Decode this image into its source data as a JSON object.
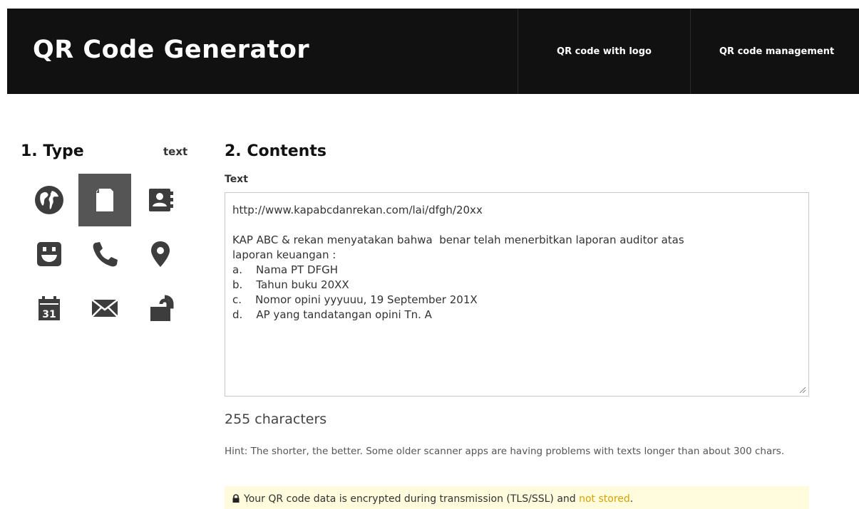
{
  "header": {
    "brand": "QR Code Generator",
    "nav": [
      "QR code with logo",
      "QR code management"
    ]
  },
  "type_section": {
    "title": "1. Type",
    "current": "text",
    "icons": [
      "globe-icon",
      "document-icon",
      "contact-card-icon",
      "smiley-icon",
      "phone-icon",
      "location-pin-icon",
      "calendar-icon",
      "envelope-icon",
      "unlock-icon"
    ],
    "calendar_day": "31",
    "selected": "document-icon"
  },
  "contents_section": {
    "title": "2. Contents",
    "field_label": "Text",
    "text_lines": [
      "http://www.kapabcdanrekan.com/lai/dfgh/20xx",
      "",
      "KAP ABC & rekan menyatakan bahwa  benar telah menerbitkan laporan auditor atas",
      "laporan keuangan :",
      "a.    Nama PT DFGH",
      "b.    Tahun buku 20XX",
      "c.    Nomor opini yyyuuu, 19 September 201X",
      "d.    AP yang tandatangan opini Tn. A"
    ],
    "char_count": "255 characters",
    "hint": "Hint: The shorter, the better. Some older scanner apps are having problems with texts longer than about 300 chars.",
    "notice_text": "Your QR code data is encrypted during transmission (TLS/SSL) and ",
    "notice_highlight": "not stored",
    "notice_end": "."
  },
  "colors": {
    "header_bg": "#111111",
    "active_tile": "#555555",
    "notice_bg": "#fffbdd",
    "notice_highlight": "#d9a400"
  }
}
